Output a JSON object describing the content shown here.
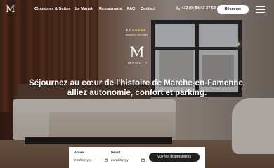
{
  "header": {
    "logo_letter": "M",
    "nav": [
      "Chambres & Suites",
      "Le Manoir",
      "Restaurants",
      "FAQ",
      "Contact"
    ],
    "phone": "+32 (0) 84/43 37 53",
    "reserve_label": "Réserver"
  },
  "rating": {
    "score": "4.7",
    "stars": "★★★★★",
    "source": "Based on 634 visits"
  },
  "brand": {
    "monogram": "M",
    "word": "MANOIR"
  },
  "hero": {
    "headline_line1": "Séjournez au cœur de l'histoire de Marche-en-Famenne,",
    "headline_line2": "alliez autonomie, confort et parking."
  },
  "booking": {
    "arrival_label": "Arrivée",
    "arrival_value": "mm/dd/yyyy",
    "departure_label": "Départ",
    "departure_value": "mm/dd/yyyy",
    "submit_label": "Voir les disponibilités"
  },
  "colors": {
    "accent_dark": "#1f1f1f",
    "star": "#f5c542",
    "wood": "#5a3322"
  }
}
